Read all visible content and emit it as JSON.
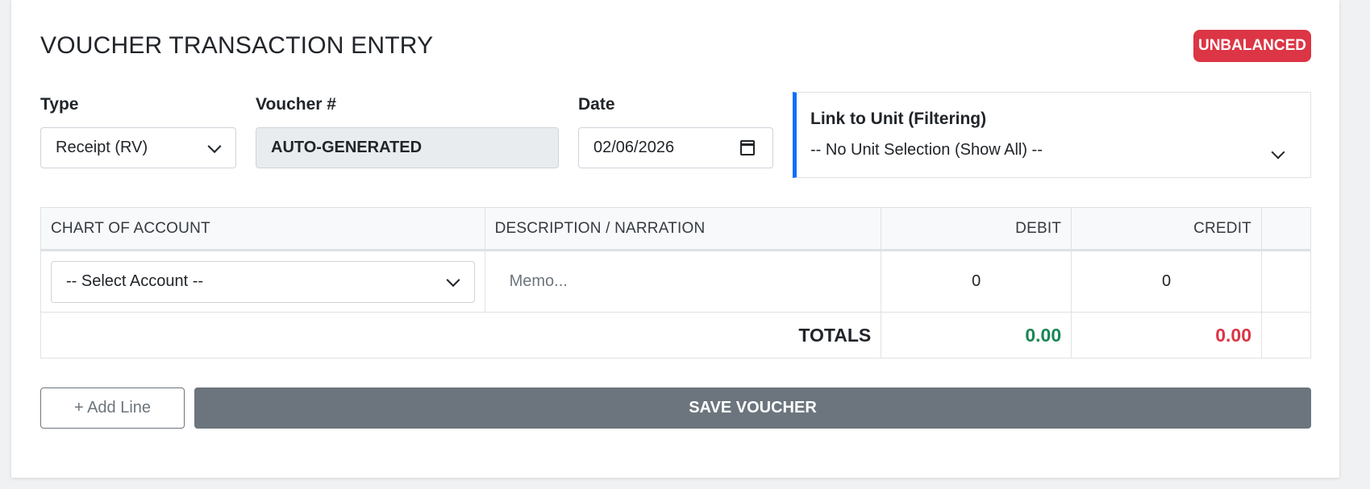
{
  "header": {
    "title": "VOUCHER TRANSACTION ENTRY",
    "status_badge": "UNBALANCED",
    "status_color": "#dc3545"
  },
  "form": {
    "type_label": "Type",
    "type_value": "Receipt (RV)",
    "voucher_label": "Voucher #",
    "voucher_value": "AUTO-GENERATED",
    "date_label": "Date",
    "date_value": "02/06/2026",
    "unit_label": "Link to Unit (Filtering)",
    "unit_value": "-- No Unit Selection (Show All) --",
    "unit_accent": "#0d6efd"
  },
  "table": {
    "headers": [
      "CHART OF ACCOUNT",
      "DESCRIPTION / NARRATION",
      "DEBIT",
      "CREDIT"
    ],
    "rows": [
      {
        "account": "-- Select Account --",
        "memo_placeholder": "Memo...",
        "debit": "0",
        "credit": "0"
      }
    ],
    "totals_label": "TOTALS",
    "total_debit": "0.00",
    "total_credit": "0.00",
    "debit_color": "#198754",
    "credit_color": "#dc3545"
  },
  "actions": {
    "add_line": "+ Add Line",
    "save": "SAVE VOUCHER"
  }
}
